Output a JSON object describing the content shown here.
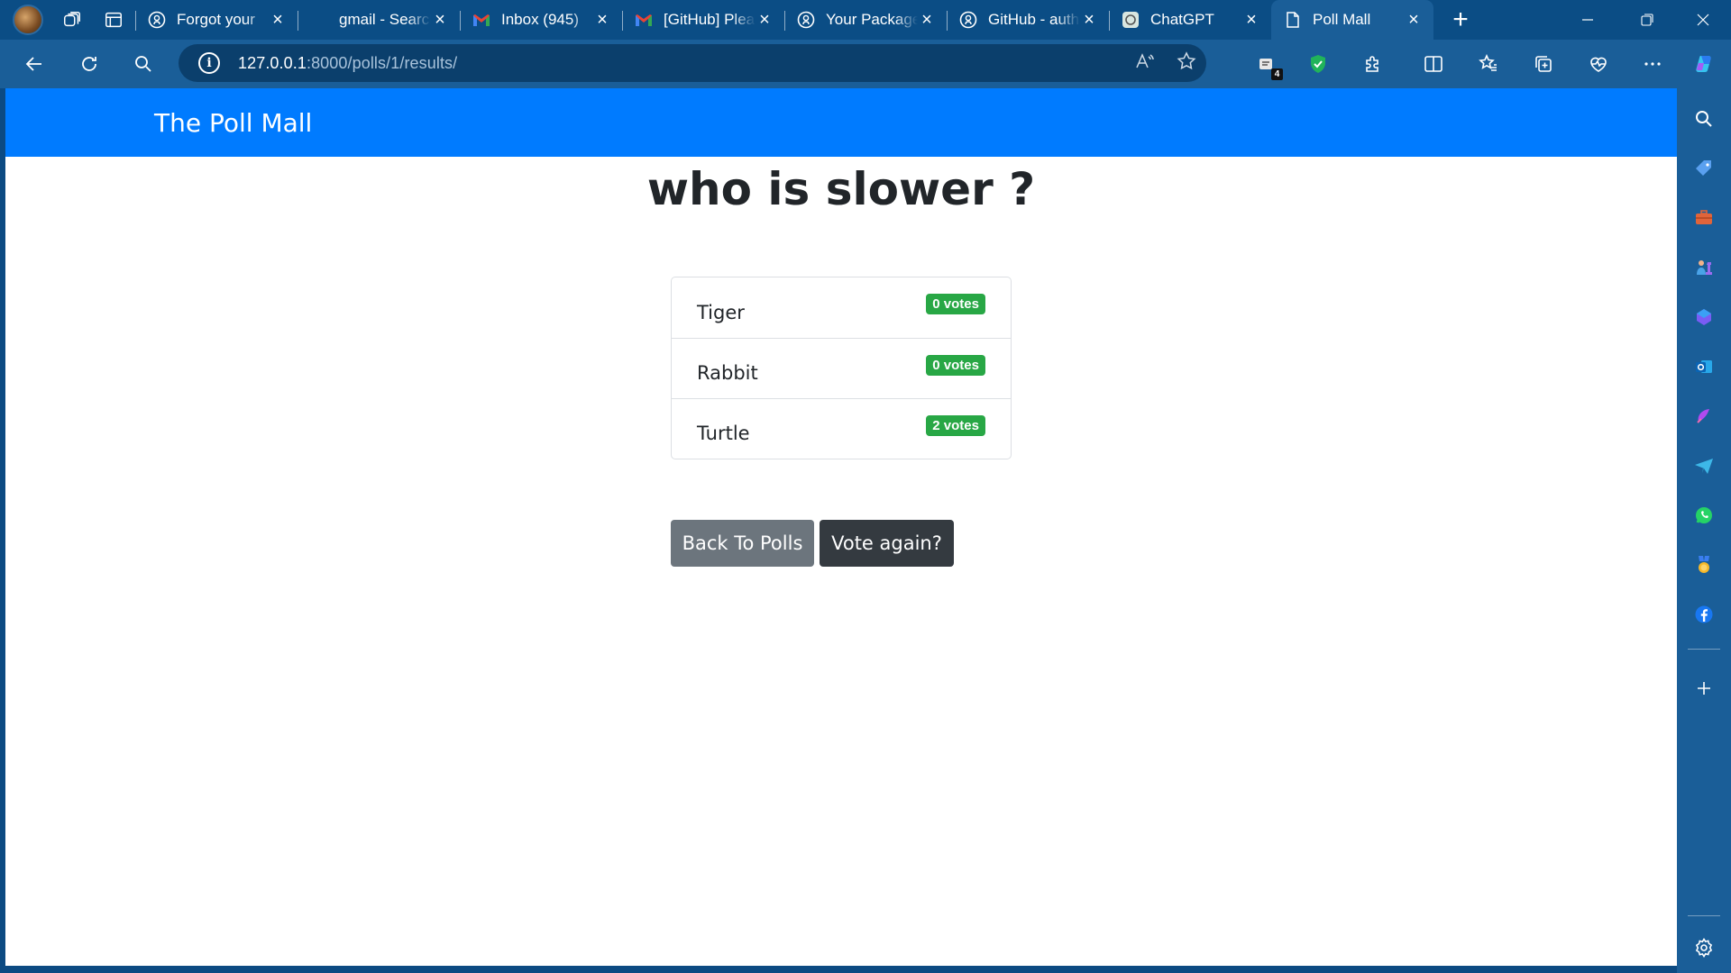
{
  "browser": {
    "tabs": [
      {
        "title": "Forgot your",
        "favicon": "github-icon"
      },
      {
        "title": "gmail - Search",
        "favicon": "search-icon"
      },
      {
        "title": "Inbox (945)",
        "favicon": "gmail-icon"
      },
      {
        "title": "[GitHub] Please",
        "favicon": "gmail-icon"
      },
      {
        "title": "Your Package",
        "favicon": "github-icon"
      },
      {
        "title": "GitHub - auth",
        "favicon": "github-icon"
      },
      {
        "title": "ChatGPT",
        "favicon": "chatgpt-icon"
      },
      {
        "title": "Poll Mall",
        "favicon": "page-icon",
        "active": true
      }
    ],
    "url_host": "127.0.0.1",
    "url_rest": ":8000/polls/1/results/",
    "extension_badge": "4"
  },
  "app": {
    "brand": "The Poll Mall",
    "brand_color": "#007bff"
  },
  "poll": {
    "question": "who is slower ?",
    "results": [
      {
        "choice": "Tiger",
        "votes": "0 votes"
      },
      {
        "choice": "Rabbit",
        "votes": "0 votes"
      },
      {
        "choice": "Turtle",
        "votes": "2 votes"
      }
    ]
  },
  "actions": {
    "back_label": "Back To Polls",
    "vote_again_label": "Vote again?"
  },
  "colors": {
    "votes_badge": "#28a745",
    "back_button": "#6c757d",
    "vote_button": "#343a40"
  }
}
